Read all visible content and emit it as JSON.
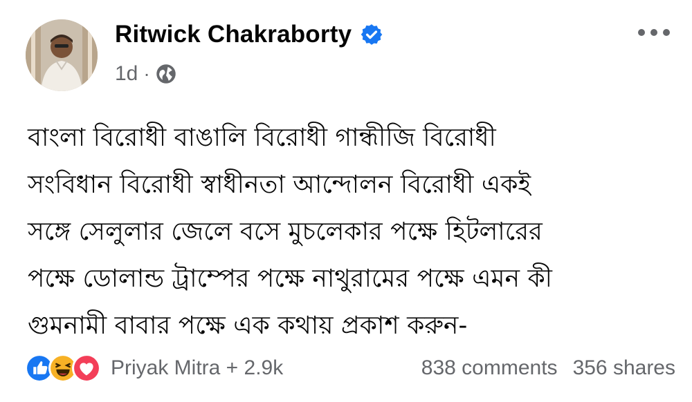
{
  "author": {
    "name": "Ritwick Chakraborty",
    "verified": true
  },
  "post_meta": {
    "time": "1d",
    "separator": "·",
    "audience_icon": "globe-icon"
  },
  "post": {
    "lines": [
      "বাংলা বিরোধী বাঙালি বিরোধী গান্ধীজি বিরোধী",
      "সংবিধান বিরোধী স্বাধীনতা আন্দোলন বিরোধী একই",
      "সঙ্গে সেলুলার জেলে বসে মুচলেকার পক্ষে হিটলারের",
      "পক্ষে ডোলান্ড ট্রাম্পের পক্ষে নাথুরামের পক্ষে এমন কী",
      "গুমনামী বাবার পক্ষে এক কথায় প্রকাশ করুন-"
    ]
  },
  "footer": {
    "reaction_icons": [
      "like-icon",
      "haha-icon",
      "love-icon"
    ],
    "reactions_text": "Priyak Mitra + 2.9k",
    "comments": "838 comments",
    "shares": "356 shares"
  },
  "colors": {
    "accent": "#1877f2",
    "secondary_text": "#65676b",
    "love": "#f33e58",
    "haha": "#f7b125"
  }
}
